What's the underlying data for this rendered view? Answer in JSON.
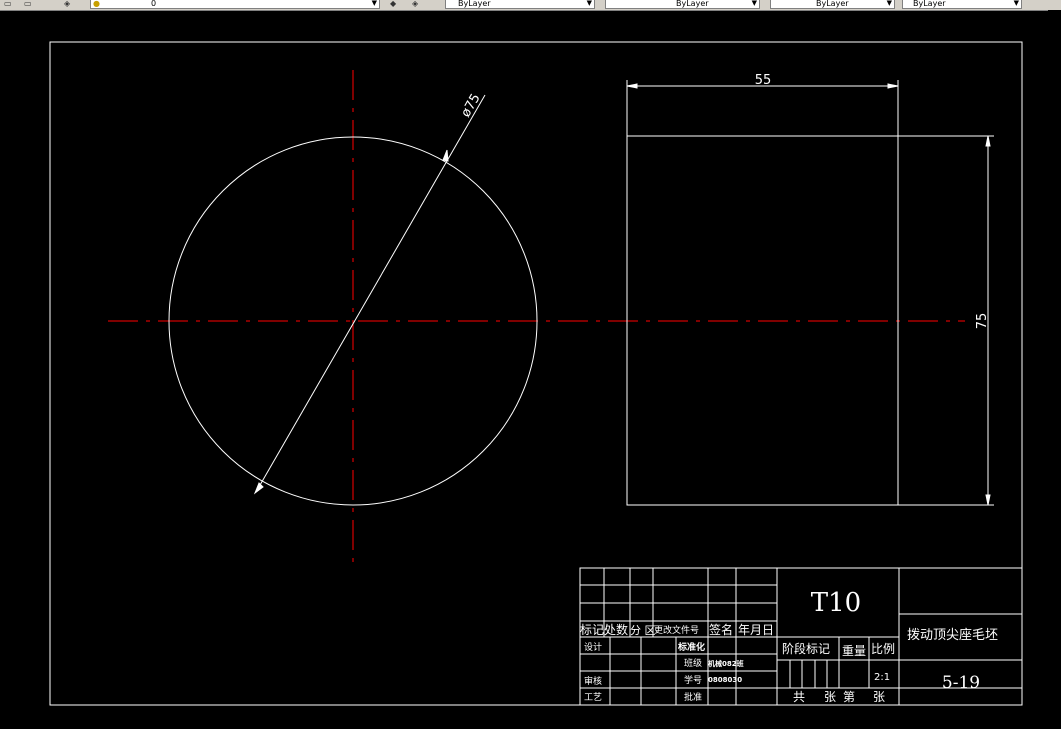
{
  "toolbar": {
    "layer_value": "0",
    "color_value": "ByLayer",
    "linetype_value": "ByLayer",
    "lineweight_value": "ByLayer",
    "plotstyle_value": "ByLayer"
  },
  "drawing": {
    "diameter_dim": "ø75",
    "width_dim": "55",
    "height_dim": "75"
  },
  "title_block": {
    "headers": {
      "mark": "标记",
      "count": "处数",
      "zone": "分 区",
      "change_doc": "更改文件号",
      "signature": "签名",
      "date": "年月日"
    },
    "rows": {
      "design": "设计",
      "standardize": "标准化",
      "class": "班级",
      "class_value": "机械082班",
      "review": "审核",
      "student_no": "学号",
      "student_no_value": "0808030",
      "process": "工艺",
      "approve": "批准"
    },
    "material": "T10",
    "stage_mark": "阶段标记",
    "weight": "重量",
    "scale_label": "比例",
    "scale_value": "2:1",
    "sheets_total": "共",
    "sheets_unit": "张",
    "sheet_no": "第",
    "sheet_unit2": "张",
    "part_name": "拨动顶尖座毛坯",
    "drawing_no": "5-19"
  },
  "colors": {
    "background": "#000000",
    "geometry": "#ffffff",
    "centerline": "#ff0000"
  }
}
